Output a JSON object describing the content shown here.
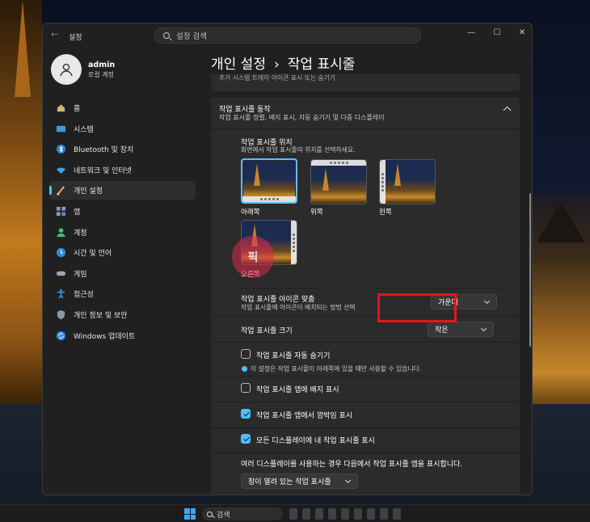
{
  "window": {
    "title": "설정",
    "search_placeholder": "설정 검색"
  },
  "user": {
    "name": "admin",
    "subtitle": "로컬 계정"
  },
  "sidebar": {
    "items": [
      {
        "label": "홈",
        "icon": "home-icon",
        "active": false
      },
      {
        "label": "시스템",
        "icon": "system-icon",
        "active": false
      },
      {
        "label": "Bluetooth 및 장치",
        "icon": "bluetooth-icon",
        "active": false
      },
      {
        "label": "네트워크 및 인터넷",
        "icon": "network-icon",
        "active": false
      },
      {
        "label": "개인 설정",
        "icon": "personalization-icon",
        "active": true
      },
      {
        "label": "앱",
        "icon": "apps-icon",
        "active": false
      },
      {
        "label": "계정",
        "icon": "accounts-icon",
        "active": false
      },
      {
        "label": "시간 및 언어",
        "icon": "time-language-icon",
        "active": false
      },
      {
        "label": "게임",
        "icon": "gaming-icon",
        "active": false
      },
      {
        "label": "접근성",
        "icon": "accessibility-icon",
        "active": false
      },
      {
        "label": "개인 정보 및 보안",
        "icon": "privacy-shield-icon",
        "active": false
      },
      {
        "label": "Windows 업데이트",
        "icon": "windows-update-icon",
        "active": false
      }
    ]
  },
  "header": {
    "parent": "개인 설정",
    "separator": "›",
    "current": "작업 표시줄"
  },
  "partial_row_text": "추가 시스템 트레이 아이콘 표시 또는 숨기기",
  "behaviors": {
    "title": "작업 표시줄 동작",
    "subtitle": "작업 표시줄 정렬, 배지 표시, 자동 숨기기 및 다중 디스플레이",
    "position": {
      "title": "작업 표시줄 위치",
      "subtitle": "화면에서 작업 표시줄의 위치를 선택하세요.",
      "options": [
        {
          "label": "아래쪽",
          "selected": true
        },
        {
          "label": "위쪽",
          "selected": false
        },
        {
          "label": "왼쪽",
          "selected": false
        },
        {
          "label": "오른쪽",
          "selected": false
        }
      ]
    },
    "alignment": {
      "title": "작업 표시줄 아이콘 맞춤",
      "subtitle": "작업 표시줄에 아이콘이 배치되는 방법 선택",
      "value": "가운데"
    },
    "size": {
      "title": "작업 표시줄 크기",
      "value": "작은"
    },
    "auto_hide": {
      "label": "작업 표시줄 자동 숨기기",
      "checked": false,
      "info": "이 설정은 작업 표시줄이 아래쪽에 있을 때만 사용할 수 있습니다."
    },
    "show_badges": {
      "label": "작업 표시줄 앱에 배지 표시",
      "checked": false
    },
    "show_flashing": {
      "label": "작업 표시줄 앱에서 깜박임 표시",
      "checked": true
    },
    "all_displays": {
      "label": "모든 디스플레이에 내 작업 표시줄 표시",
      "checked": true
    },
    "multi_display": {
      "title": "여러 디스플레이를 사용하는 경우 다음에서 작업 표시줄 앱을 표시합니다.",
      "value": "창이 열려 있는 작업 표시줄"
    }
  },
  "taskbar": {
    "search_label": "검색"
  },
  "watermark_text": "픽",
  "colors": {
    "accent": "#4cc2ff",
    "highlight": "#e8131c",
    "window_bg": "#202020",
    "card_bg": "#2b2b2b"
  }
}
